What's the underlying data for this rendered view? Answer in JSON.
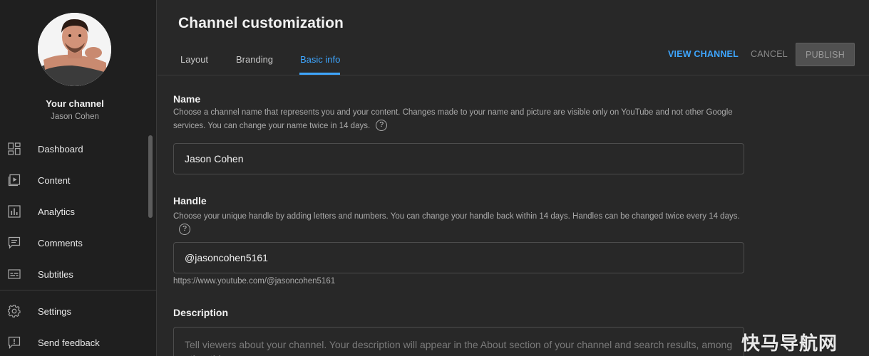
{
  "sidebar": {
    "channel_title": "Your channel",
    "channel_name": "Jason Cohen",
    "items": [
      {
        "label": "Dashboard",
        "icon": "dashboard-icon"
      },
      {
        "label": "Content",
        "icon": "content-play-icon"
      },
      {
        "label": "Analytics",
        "icon": "analytics-bar-icon"
      },
      {
        "label": "Comments",
        "icon": "comments-icon"
      },
      {
        "label": "Subtitles",
        "icon": "subtitles-icon"
      }
    ],
    "bottom_items": [
      {
        "label": "Settings",
        "icon": "gear-icon"
      },
      {
        "label": "Send feedback",
        "icon": "feedback-icon"
      }
    ]
  },
  "header": {
    "title": "Channel customization",
    "tabs": [
      {
        "label": "Layout",
        "active": false
      },
      {
        "label": "Branding",
        "active": false
      },
      {
        "label": "Basic info",
        "active": true
      }
    ],
    "view_channel_label": "VIEW CHANNEL",
    "cancel_label": "CANCEL",
    "publish_label": "PUBLISH"
  },
  "form": {
    "name": {
      "title": "Name",
      "description": "Choose a channel name that represents you and your content. Changes made to your name and picture are visible only on YouTube and not other Google services. You can change your name twice in 14 days.",
      "value": "Jason Cohen"
    },
    "handle": {
      "title": "Handle",
      "description": "Choose your unique handle by adding letters and numbers. You can change your handle back within 14 days. Handles can be changed twice every 14 days.",
      "value": "@jasoncohen5161",
      "url": "https://www.youtube.com/@jasoncohen5161"
    },
    "description": {
      "title": "Description",
      "placeholder": "Tell viewers about your channel. Your description will appear in the About section of your channel and search results, among other things."
    }
  },
  "help_glyph": "?",
  "watermark": "快马导航网",
  "colors": {
    "accent": "#3ea6ff",
    "background": "#282828",
    "sidebar": "#1f1f1f"
  }
}
